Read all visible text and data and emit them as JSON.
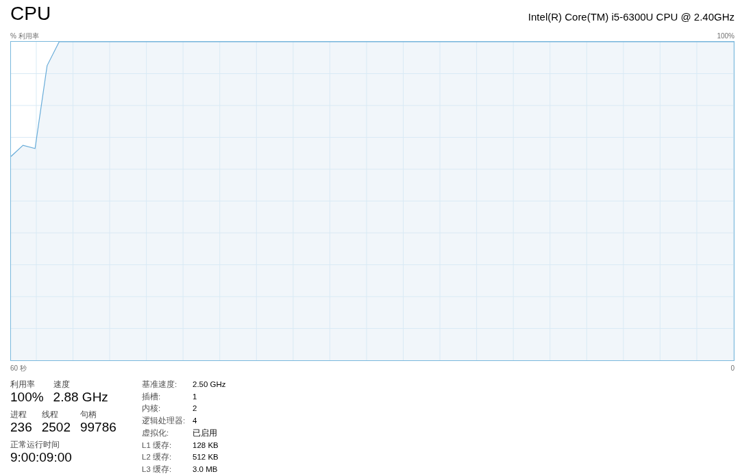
{
  "header": {
    "title": "CPU",
    "processor": "Intel(R) Core(TM) i5-6300U CPU @ 2.40GHz"
  },
  "graph": {
    "y_label": "% 利用率",
    "y_max_label": "100%",
    "x_start_label": "60 秒",
    "x_end_label": "0"
  },
  "stat_rows": [
    [
      {
        "label": "利用率",
        "value": "100%"
      },
      {
        "label": "速度",
        "value": "2.88 GHz"
      }
    ],
    [
      {
        "label": "进程",
        "value": "236"
      },
      {
        "label": "线程",
        "value": "2502"
      },
      {
        "label": "句柄",
        "value": "99786"
      }
    ],
    [
      {
        "label": "正常运行时间",
        "value": "9:00:09:00"
      }
    ]
  ],
  "details": [
    {
      "label": "基准速度:",
      "value": "2.50 GHz"
    },
    {
      "label": "插槽:",
      "value": "1"
    },
    {
      "label": "内核:",
      "value": "2"
    },
    {
      "label": "逻辑处理器:",
      "value": "4"
    },
    {
      "label": "虚拟化:",
      "value": "已启用"
    },
    {
      "label": "L1 缓存:",
      "value": "128 KB"
    },
    {
      "label": "L2 缓存:",
      "value": "512 KB"
    },
    {
      "label": "L3 缓存:",
      "value": "3.0 MB"
    }
  ]
}
